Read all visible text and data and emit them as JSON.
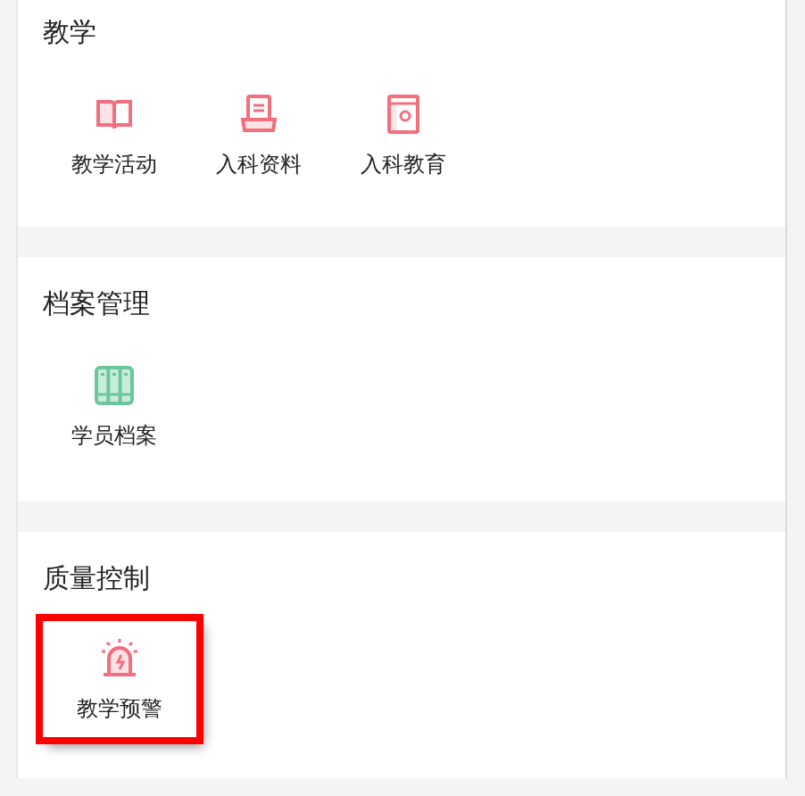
{
  "sections": [
    {
      "title": "教学",
      "items": [
        {
          "label": "教学活动",
          "kind": "book",
          "highlighted": false
        },
        {
          "label": "入科资料",
          "kind": "tray",
          "highlighted": false
        },
        {
          "label": "入科教育",
          "kind": "flowerbook",
          "highlighted": false
        }
      ]
    },
    {
      "title": "档案管理",
      "items": [
        {
          "label": "学员档案",
          "kind": "binders",
          "highlighted": false
        }
      ]
    },
    {
      "title": "质量控制",
      "items": [
        {
          "label": "教学预警",
          "kind": "siren",
          "highlighted": true
        }
      ]
    }
  ]
}
